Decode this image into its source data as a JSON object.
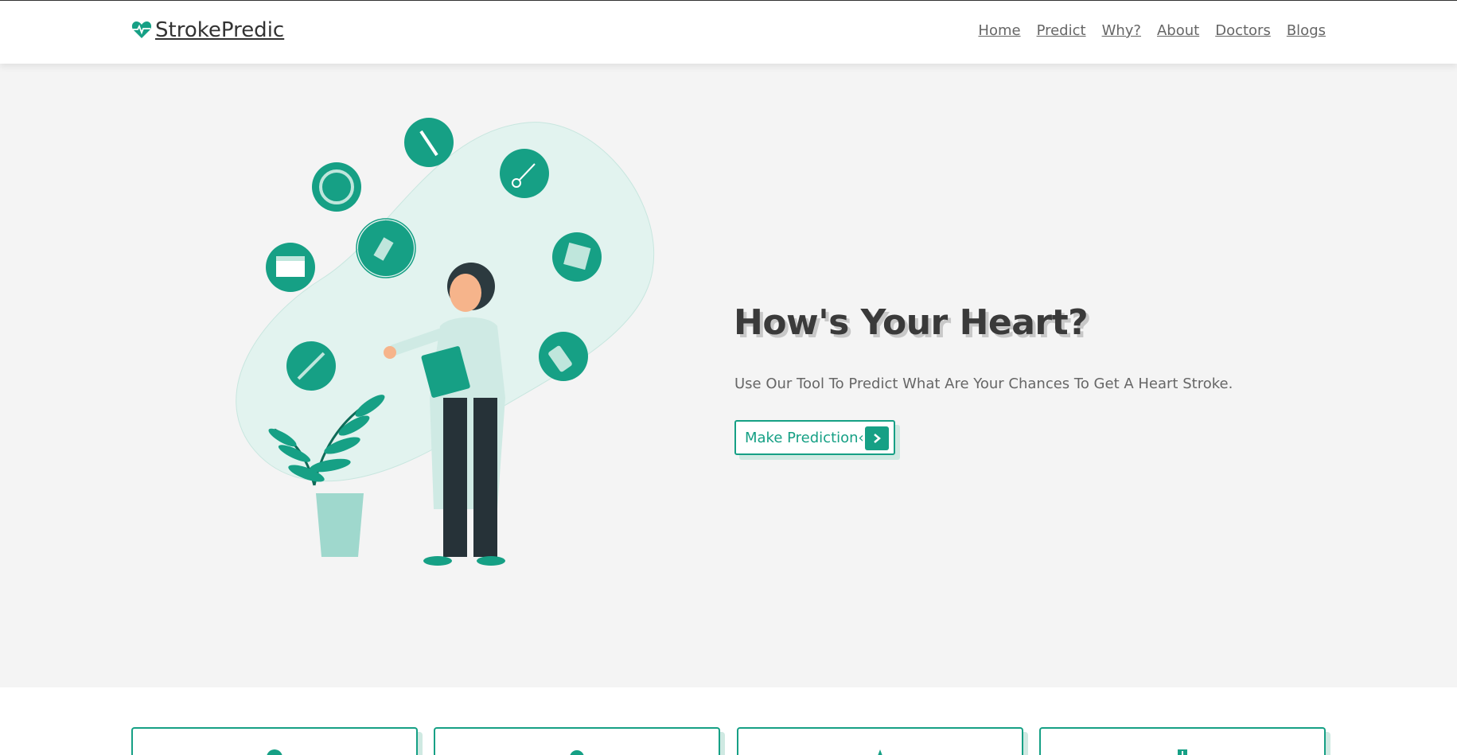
{
  "brand": {
    "name": "StrokePredic",
    "accent": "#16a085"
  },
  "nav": {
    "items": [
      "Home",
      "Predict",
      "Why?",
      "About",
      "Doctors",
      "Blogs"
    ]
  },
  "hero": {
    "title": "How's Your Heart?",
    "subtitle": "Use Our Tool To Predict What Are Your Chances To Get A Heart Stroke.",
    "cta_label": "Make Prediction‹"
  },
  "icons": {
    "logo": "heart-pulse-icon",
    "cta": "chevron-right-icon",
    "cards": [
      "user-icon",
      "user-icon",
      "star-icon",
      "medical-icon"
    ]
  }
}
